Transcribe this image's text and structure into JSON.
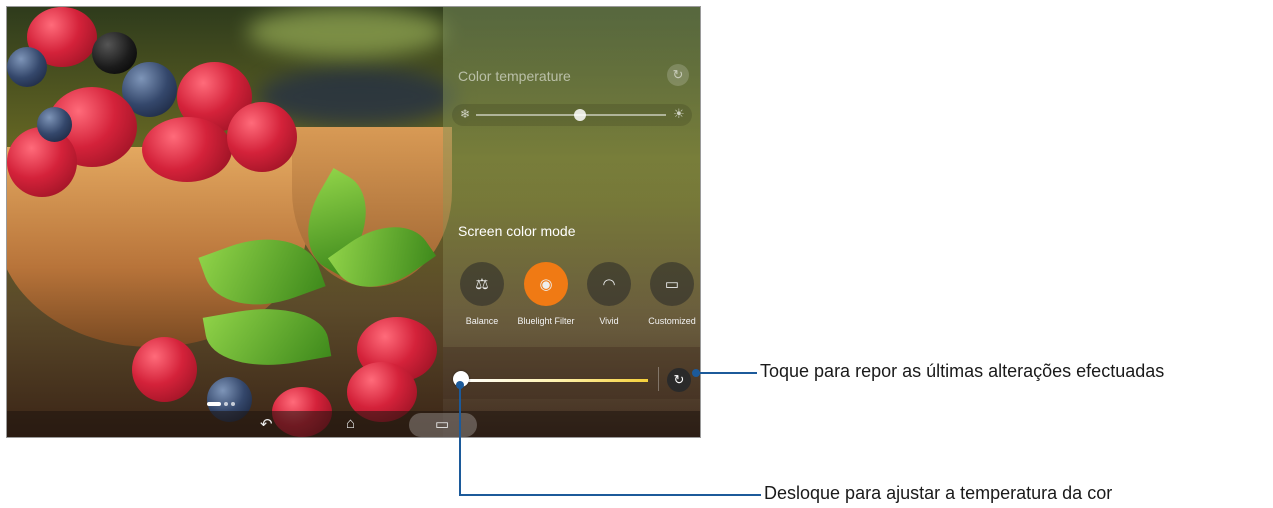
{
  "panel": {
    "color_temperature_title": "Color temperature",
    "screen_color_mode_title": "Screen color mode",
    "modes": [
      {
        "label": "Balance",
        "icon": "balance-icon",
        "active": false
      },
      {
        "label": "Bluelight Filter",
        "icon": "eye-shield-icon",
        "active": true
      },
      {
        "label": "Vivid",
        "icon": "vivid-icon",
        "active": false
      },
      {
        "label": "Customized",
        "icon": "customized-icon",
        "active": false
      }
    ],
    "color_temperature_level": 0.5,
    "bluelight_level": 0.0
  },
  "icons": {
    "reset": "↻",
    "snow": "❄",
    "sun": "☀",
    "back": "↶",
    "home": "⌂",
    "recent": "▭",
    "balance": "⚖",
    "eye_shield": "◉",
    "vivid": "◠",
    "customized": "▭"
  },
  "callouts": {
    "reset": "Toque para repor as últimas alterações efectuadas",
    "slider": "Desloque para ajustar a temperatura da cor"
  },
  "colors": {
    "accent": "#f07a14",
    "callout": "#1c5a9a"
  }
}
